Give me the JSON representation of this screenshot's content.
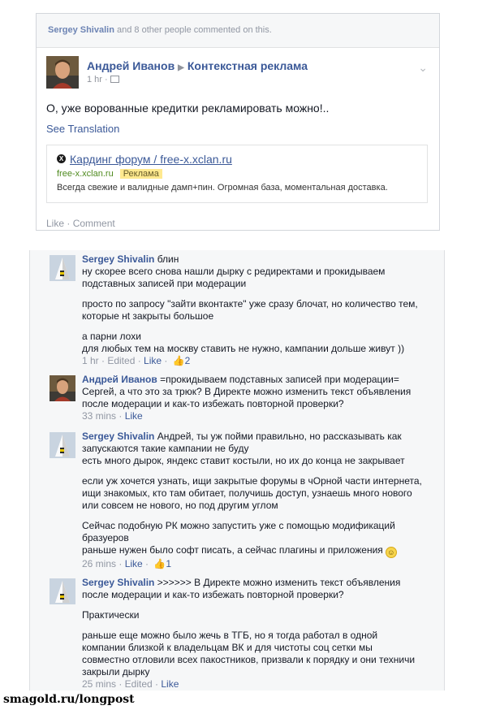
{
  "post": {
    "header": {
      "name": "Sergey Shivalin",
      "rest": " and 8 other people commented on this."
    },
    "author": "Андрей Иванов",
    "arrow": "▶",
    "page_name": "Контекстная реклама",
    "time": "1 hr ·",
    "chevron": "⌄",
    "text": "О, уже ворованные кредитки рекламировать можно!..",
    "see_translation": "See Translation",
    "ad": {
      "icon": "X",
      "title": "Кардинг форум / free-x.xclan.ru",
      "url": "free-x.xclan.ru",
      "badge": "Реклама",
      "description": "Всегда свежие и валидные дамп+пин. Огромная база, моментальная доставка."
    },
    "actions": {
      "like": "Like",
      "sep": " · ",
      "comment": "Comment"
    }
  },
  "comments": [
    {
      "author": "Sergey Shivalin",
      "lines": [
        {
          "text": "блин\nну скорее всего снова нашли дырку с редиректами и прокидываем\nподставных записей при модерации"
        },
        {
          "text": "просто по запросу \"зайти вконтакте\" уже сразу блочат, но количество тем,\nкоторые нt закрыты большое"
        },
        {
          "text": "а парни лохи\nдля любых тем на москву ставить не нужно, кампании дольше живут ))"
        }
      ],
      "time": "1 hr · Edited · ",
      "like": "Like",
      "sep": " · ",
      "likes": "2"
    },
    {
      "author": "Андрей Иванов",
      "text": "=прокидываем подставных записей при модерации=\nСергей, а что это за трюк? В Директе можно изменить текст объявления\nпосле модерации и как-то избежать повторной проверки?",
      "time": "33 mins · ",
      "like": "Like"
    },
    {
      "author": "Sergey Shivalin",
      "lines": [
        {
          "text": "Андрей, ты уж пойми правильно, но рассказывать как\nзапускаются такие кампании не буду\nесть много дырок, яндекс ставит костыли, но их до конца не закрывает"
        },
        {
          "text": "если уж хочется узнать, ищи закрытые форумы в чОрной части интернета,\nищи знакомых, кто там обитает, получишь доступ, узнаешь много нового\nили совсем не нового, но под другим углом"
        },
        {
          "text": "Сейчас подобную РК можно запустить уже с помощью модификаций\nбразуеров\nраньше нужен было софт писать, а сейчас плагины и приложения"
        }
      ],
      "time": "26 mins · ",
      "like": "Like",
      "sep": " · ",
      "likes": "1"
    },
    {
      "author": "Sergey Shivalin",
      "lines": [
        {
          "text": ">>>>>> В Директе можно изменить текст объявления\nпосле модерации и как-то избежать повторной проверки?"
        },
        {
          "text": "Практически"
        },
        {
          "text": "раньше еще можно было жечь в ТГБ, но я тогда работал в одной\nкомпании близкой к владельцам ВК и для чистоты соц сетки мы\nсовместно отловили всех пакостников, призвали к порядку и они техничи\nзакрыли дырку"
        }
      ],
      "time": "25 mins · Edited · ",
      "like": "Like"
    }
  ],
  "footer": "smagold.ru/longpost"
}
